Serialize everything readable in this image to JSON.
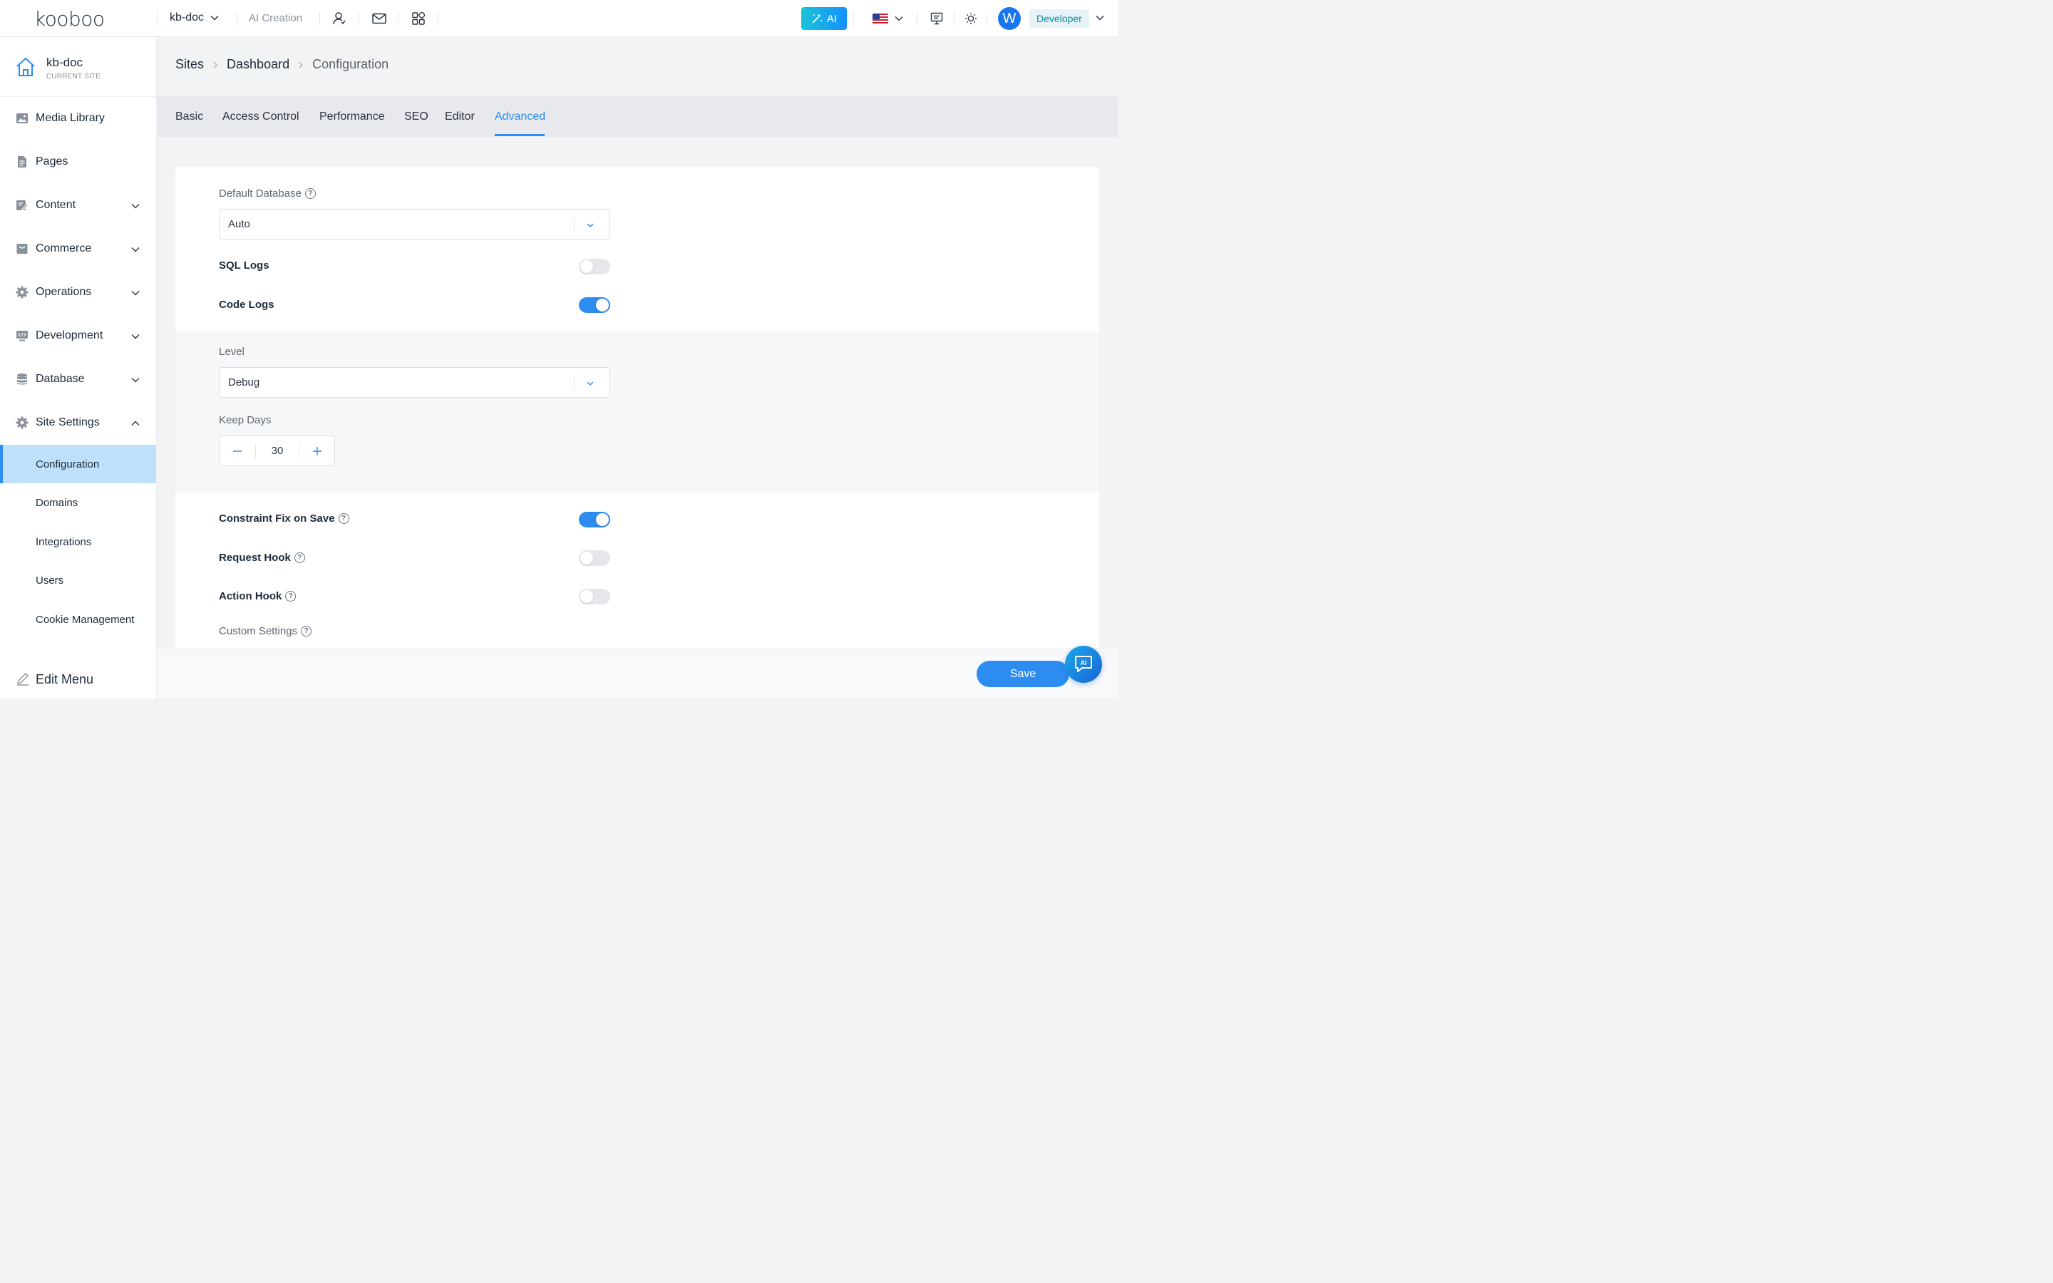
{
  "brand": {
    "logo_text": "kooboo"
  },
  "topbar": {
    "site_name": "kb-doc",
    "ai_creation": "AI Creation",
    "ai_button": "AI",
    "avatar_letter": "W",
    "role": "Developer",
    "icons": [
      "user-icon",
      "mail-icon",
      "apps-icon",
      "flag-icon",
      "presentation-icon",
      "theme-icon"
    ]
  },
  "sidebar": {
    "site_name": "kb-doc",
    "site_sub": "CURRENT SITE",
    "items": [
      {
        "label": "Media Library",
        "icon": "image-icon"
      },
      {
        "label": "Pages",
        "icon": "document-icon"
      },
      {
        "label": "Content",
        "icon": "edit-icon"
      },
      {
        "label": "Commerce",
        "icon": "bag-icon"
      },
      {
        "label": "Operations",
        "icon": "gear-icon"
      },
      {
        "label": "Development",
        "icon": "code-icon"
      },
      {
        "label": "Database",
        "icon": "database-icon"
      },
      {
        "label": "Site Settings",
        "icon": "gear-icon"
      }
    ],
    "sub_items": [
      {
        "label": "Configuration"
      },
      {
        "label": "Domains"
      },
      {
        "label": "Integrations"
      },
      {
        "label": "Users"
      },
      {
        "label": "Cookie Management"
      }
    ],
    "edit_menu": "Edit Menu"
  },
  "breadcrumb": {
    "sites": "Sites",
    "dashboard": "Dashboard",
    "current": "Configuration"
  },
  "tabs": [
    {
      "label": "Basic"
    },
    {
      "label": "Access Control"
    },
    {
      "label": "Performance"
    },
    {
      "label": "SEO"
    },
    {
      "label": "Editor"
    },
    {
      "label": "Advanced"
    }
  ],
  "form": {
    "default_database": {
      "label": "Default Database",
      "value": "Auto"
    },
    "sql_logs": {
      "label": "SQL Logs",
      "enabled": false
    },
    "code_logs": {
      "label": "Code Logs",
      "enabled": true
    },
    "level": {
      "label": "Level",
      "value": "Debug"
    },
    "keep_days": {
      "label": "Keep Days",
      "value": "30"
    },
    "constraint_fix": {
      "label": "Constraint Fix on Save",
      "enabled": true
    },
    "request_hook": {
      "label": "Request Hook",
      "enabled": false
    },
    "action_hook": {
      "label": "Action Hook",
      "enabled": false
    },
    "custom_settings": {
      "label": "Custom Settings"
    }
  },
  "actions": {
    "save": "Save"
  },
  "colors": {
    "accent": "#2d8cf0",
    "active_bg": "#bfe0fb",
    "ai_gradient_start": "#19c3d6"
  }
}
